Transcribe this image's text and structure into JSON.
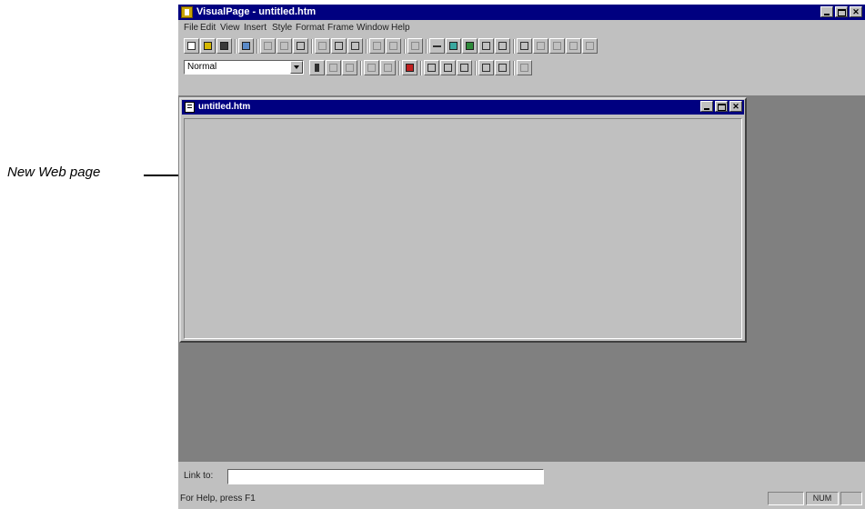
{
  "callout": {
    "label": "New Web page"
  },
  "app": {
    "title": "VisualPage - untitled.htm"
  },
  "menu": {
    "items": [
      "File",
      "Edit",
      "View",
      "Insert",
      "Style",
      "Format",
      "Frame",
      "Window",
      "Help"
    ]
  },
  "format_toolbar": {
    "style_value": "Normal"
  },
  "document": {
    "title": "untitled.htm"
  },
  "link_bar": {
    "label": "Link to:",
    "value": ""
  },
  "status_bar": {
    "text": "For Help, press F1",
    "num_indicator": "NUM"
  },
  "colors": {
    "titlebar": "#000080",
    "face": "#c0c0c0",
    "workspace": "#808080"
  }
}
